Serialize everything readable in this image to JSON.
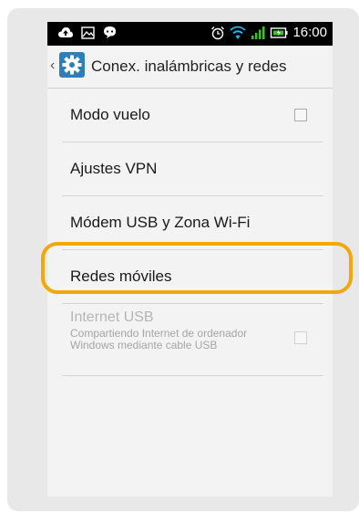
{
  "status_bar": {
    "left_icons": [
      "cloud-upload-icon",
      "image-icon",
      "chat-icon"
    ],
    "right_icons": [
      "alarm-icon",
      "wifi-icon",
      "signal-icon",
      "battery-icon"
    ],
    "time": "16:00"
  },
  "action_bar": {
    "title": "Conex. inalámbricas y redes",
    "icon": "settings-icon"
  },
  "settings": {
    "items": [
      {
        "label": "Modo vuelo",
        "has_checkbox": true,
        "checked": false
      },
      {
        "label": "Ajustes VPN"
      },
      {
        "label": "Módem USB y Zona Wi-Fi"
      },
      {
        "label": "Redes móviles",
        "highlighted": true
      },
      {
        "label": "Internet USB",
        "summary": "Compartiendo Internet de ordenador Windows mediante cable USB",
        "disabled": true,
        "has_checkbox": true,
        "checked": false
      }
    ]
  },
  "colors": {
    "status_bar_bg": "#000000",
    "highlight": "#f0a90d",
    "settings_icon": "#2d7fb6",
    "screen_bg": "#f3f3f3"
  }
}
